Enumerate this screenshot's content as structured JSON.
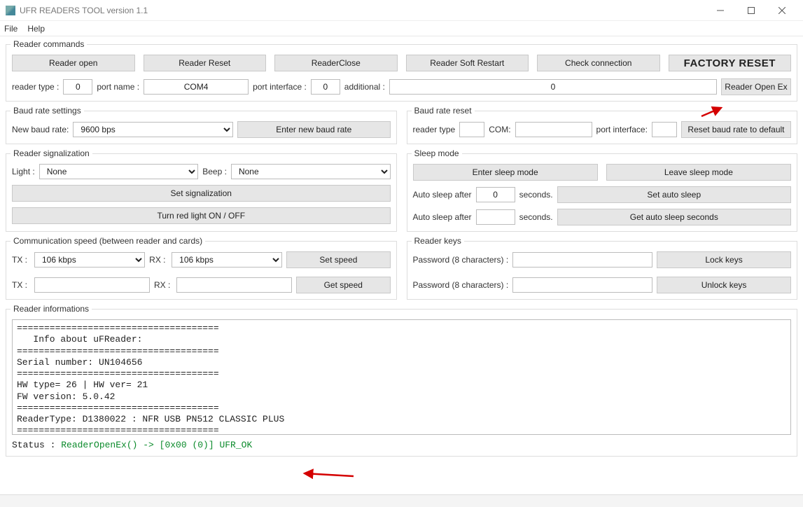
{
  "window": {
    "title": "UFR READERS TOOL version 1.1"
  },
  "menu": {
    "file": "File",
    "help": "Help"
  },
  "readerCommands": {
    "legend": "Reader commands",
    "open": "Reader open",
    "reset": "Reader Reset",
    "close": "ReaderClose",
    "soft": "Reader Soft Restart",
    "check": "Check connection",
    "factory": "FACTORY RESET",
    "readerTypeLabel": "reader type :",
    "readerType": "0",
    "portNameLabel": "port name :",
    "portName": "COM4",
    "portInterfaceLabel": "port interface :",
    "portInterface": "0",
    "additionalLabel": "additional :",
    "additional": "0",
    "openEx": "Reader Open Ex"
  },
  "baudSettings": {
    "legend": "Baud rate settings",
    "newLabel": "New baud rate:",
    "value": "9600 bps",
    "enter": "Enter new baud rate"
  },
  "baudReset": {
    "legend": "Baud rate reset",
    "readerTypeLabel": "reader type",
    "readerType": "",
    "comLabel": "COM:",
    "com": "",
    "portInterfaceLabel": "port interface:",
    "portInterface": "",
    "reset": "Reset baud rate to default"
  },
  "signal": {
    "legend": "Reader signalization",
    "lightLabel": "Light :",
    "light": "None",
    "beepLabel": "Beep :",
    "beep": "None",
    "set": "Set signalization",
    "redLight": "Turn red light ON / OFF"
  },
  "sleep": {
    "legend": "Sleep mode",
    "enter": "Enter sleep mode",
    "leave": "Leave sleep mode",
    "afterLabel": "Auto sleep after",
    "after1": "0",
    "after2": "",
    "secondsLabel": "seconds.",
    "set": "Set auto sleep",
    "get": "Get auto sleep seconds"
  },
  "commSpeed": {
    "legend": "Communication speed (between reader and cards)",
    "txLabel": "TX :",
    "rxLabel": "RX :",
    "tx": "106 kbps",
    "rx": "106 kbps",
    "set": "Set speed",
    "get": "Get speed",
    "txRead": "",
    "rxRead": ""
  },
  "keys": {
    "legend": "Reader keys",
    "pwLabel": "Password (8 characters) :",
    "lockPw": "",
    "unlockPw": "",
    "lock": "Lock keys",
    "unlock": "Unlock keys"
  },
  "info": {
    "legend": "Reader informations",
    "text": "=====================================\n   Info about uFReader:\n=====================================\nSerial number: UN104656\n=====================================\nHW type= 26 | HW ver= 21\nFW version: 5.0.42\n=====================================\nReaderType: D1380022 : NFR USB PN512 CLASSIC PLUS\n=====================================",
    "statusLabel": "Status : ",
    "statusVal": "ReaderOpenEx() -> [0x00 (0)] UFR_OK"
  }
}
